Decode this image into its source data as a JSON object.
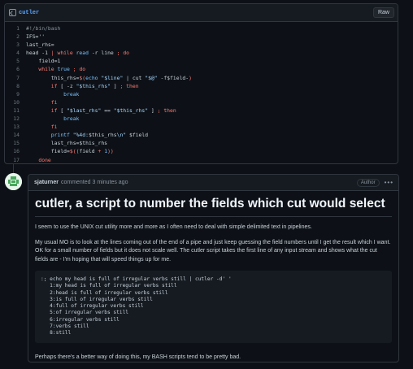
{
  "file": {
    "name": "cutler",
    "raw_label": "Raw",
    "lines": [
      {
        "n": "1",
        "tokens": [
          {
            "t": "#!/bin/bash",
            "c": "#8b949e"
          }
        ]
      },
      {
        "n": "2",
        "tokens": [
          {
            "t": "IFS=''",
            "c": "#c9d1d9"
          }
        ]
      },
      {
        "n": "3",
        "tokens": [
          {
            "t": "last_rhs=",
            "c": "#c9d1d9"
          }
        ]
      },
      {
        "n": "4",
        "tokens": [
          {
            "t": "head -1 ",
            "c": "#c9d1d9"
          },
          {
            "t": "|",
            "c": "#ff7b72"
          },
          {
            "t": " while",
            "c": "#ff7b72"
          },
          {
            "t": " read",
            "c": "#79c0ff"
          },
          {
            "t": " -r line ",
            "c": "#c9d1d9"
          },
          {
            "t": ";",
            "c": "#ff7b72"
          },
          {
            "t": " do",
            "c": "#ff7b72"
          }
        ]
      },
      {
        "n": "5",
        "tokens": [
          {
            "t": "    field=1",
            "c": "#c9d1d9"
          }
        ]
      },
      {
        "n": "6",
        "tokens": [
          {
            "t": "    while",
            "c": "#ff7b72"
          },
          {
            "t": " true",
            "c": "#79c0ff"
          },
          {
            "t": " ;",
            "c": "#ff7b72"
          },
          {
            "t": " do",
            "c": "#ff7b72"
          }
        ]
      },
      {
        "n": "7",
        "tokens": [
          {
            "t": "        this_rhs=",
            "c": "#c9d1d9"
          },
          {
            "t": "$(",
            "c": "#ff7b72"
          },
          {
            "t": "echo ",
            "c": "#79c0ff"
          },
          {
            "t": "\"$line\"",
            "c": "#a5d6ff"
          },
          {
            "t": " | cut ",
            "c": "#c9d1d9"
          },
          {
            "t": "\"$@\"",
            "c": "#a5d6ff"
          },
          {
            "t": " -f$field-",
            "c": "#c9d1d9"
          },
          {
            "t": ")",
            "c": "#ff7b72"
          }
        ]
      },
      {
        "n": "8",
        "tokens": [
          {
            "t": "        if",
            "c": "#ff7b72"
          },
          {
            "t": " [ -z ",
            "c": "#c9d1d9"
          },
          {
            "t": "\"$this_rhs\"",
            "c": "#a5d6ff"
          },
          {
            "t": " ] ",
            "c": "#c9d1d9"
          },
          {
            "t": ";",
            "c": "#ff7b72"
          },
          {
            "t": " then",
            "c": "#ff7b72"
          }
        ]
      },
      {
        "n": "9",
        "tokens": [
          {
            "t": "            break",
            "c": "#79c0ff"
          }
        ]
      },
      {
        "n": "10",
        "tokens": [
          {
            "t": "        fi",
            "c": "#ff7b72"
          }
        ]
      },
      {
        "n": "11",
        "tokens": [
          {
            "t": "        if",
            "c": "#ff7b72"
          },
          {
            "t": " [ ",
            "c": "#c9d1d9"
          },
          {
            "t": "\"$last_rhs\"",
            "c": "#a5d6ff"
          },
          {
            "t": " == ",
            "c": "#c9d1d9"
          },
          {
            "t": "\"$this_rhs\"",
            "c": "#a5d6ff"
          },
          {
            "t": " ] ",
            "c": "#c9d1d9"
          },
          {
            "t": ";",
            "c": "#ff7b72"
          },
          {
            "t": " then",
            "c": "#ff7b72"
          }
        ]
      },
      {
        "n": "12",
        "tokens": [
          {
            "t": "            break",
            "c": "#79c0ff"
          }
        ]
      },
      {
        "n": "13",
        "tokens": [
          {
            "t": "        fi",
            "c": "#ff7b72"
          }
        ]
      },
      {
        "n": "14",
        "tokens": [
          {
            "t": "        printf",
            "c": "#79c0ff"
          },
          {
            "t": " \"%4d:",
            "c": "#a5d6ff"
          },
          {
            "t": "$this_rhs",
            "c": "#c9d1d9"
          },
          {
            "t": "\\n\"",
            "c": "#a5d6ff"
          },
          {
            "t": " $field",
            "c": "#c9d1d9"
          }
        ]
      },
      {
        "n": "15",
        "tokens": [
          {
            "t": "        last_rhs=$this_rhs",
            "c": "#c9d1d9"
          }
        ]
      },
      {
        "n": "16",
        "tokens": [
          {
            "t": "        field=",
            "c": "#c9d1d9"
          },
          {
            "t": "$((",
            "c": "#ff7b72"
          },
          {
            "t": "field ",
            "c": "#c9d1d9"
          },
          {
            "t": "+",
            "c": "#ff7b72"
          },
          {
            "t": " 1",
            "c": "#79c0ff"
          },
          {
            "t": "))",
            "c": "#ff7b72"
          }
        ]
      },
      {
        "n": "17",
        "tokens": [
          {
            "t": "    done",
            "c": "#ff7b72"
          }
        ]
      },
      {
        "n": "18",
        "tokens": [
          {
            "t": "done",
            "c": "#ff7b72"
          }
        ]
      }
    ]
  },
  "comment": {
    "author": "sjaturner",
    "meta": "commented 3 minutes ago",
    "badge": "Author",
    "menu": "•••",
    "title": "cutler, a script to number the fields which cut would select",
    "para1": "I seem to use the UNIX cut utility more and more as I often need to deal with simple delimited text in pipelines.",
    "para2": "My usual MO is to look at the lines coming out of the end of a pipe and just keep guessing the field numbers until I get the result which I want. OK for a small number of fields but it does not scale well. The cutler script takes the first line of any input stream and shows what the cut fields are - I'm hoping that will speed things up for me.",
    "code_lines": [
      ":; echo my head is full of irregular verbs still | cutler -d' '",
      "   1:my head is full of irregular verbs still",
      "   2:head is full of irregular verbs still",
      "   3:is full of irregular verbs still",
      "   4:full of irregular verbs still",
      "   5:of irregular verbs still",
      "   6:irregular verbs still",
      "   7:verbs still",
      "   8:still"
    ],
    "para3": "Perhaps there's a better way of doing this, my BASH scripts tend to be pretty bad."
  }
}
